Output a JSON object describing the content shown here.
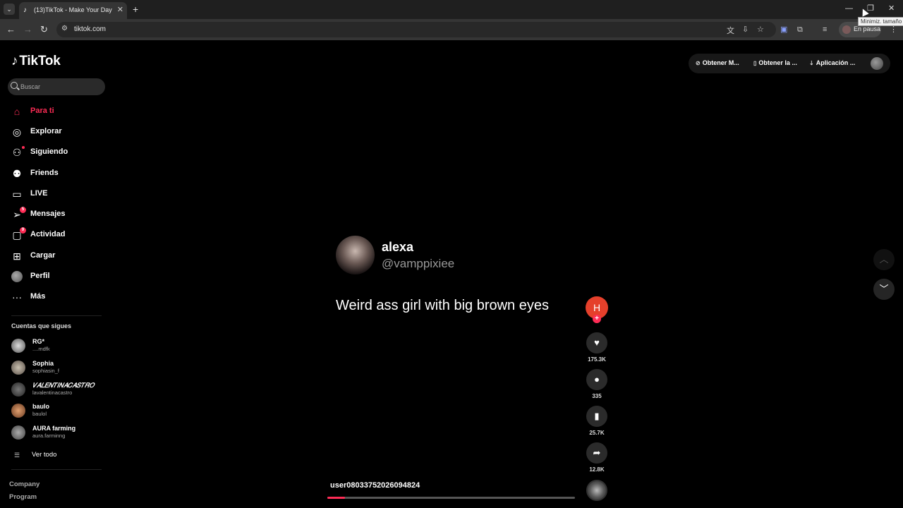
{
  "browser": {
    "tab_title": "(13)TikTok - Make Your Day",
    "url": "tiktok.com",
    "profile_label": "En pausa",
    "tooltip": "Minimiz. tamaño"
  },
  "sidebar": {
    "logo": "TikTok",
    "search_placeholder": "Buscar",
    "nav": [
      {
        "label": "Para ti",
        "icon": "home-icon"
      },
      {
        "label": "Explorar",
        "icon": "compass-icon"
      },
      {
        "label": "Siguiendo",
        "icon": "following-icon"
      },
      {
        "label": "Friends",
        "icon": "friends-icon"
      },
      {
        "label": "LIVE",
        "icon": "live-icon"
      },
      {
        "label": "Mensajes",
        "icon": "messages-icon",
        "badge": "5"
      },
      {
        "label": "Actividad",
        "icon": "activity-icon",
        "badge": "9"
      },
      {
        "label": "Cargar",
        "icon": "upload-icon"
      },
      {
        "label": "Perfil",
        "icon": "profile-icon"
      },
      {
        "label": "Más",
        "icon": "more-icon"
      }
    ],
    "following_title": "Cuentas que sigues",
    "following": [
      {
        "name": "RG*",
        "handle": "....mdfk"
      },
      {
        "name": "Sophia",
        "handle": "sophiasin_f"
      },
      {
        "name": "𝑉𝐴𝐿𝐸𝑁𝑇𝐼𝑁𝐴𝐶𝐴𝑆𝑇𝑅𝑂",
        "handle": "lavalentinacastro"
      },
      {
        "name": "baulo",
        "handle": "baulol"
      },
      {
        "name": "AURA farming",
        "handle": "aura.farminng"
      }
    ],
    "see_all": "Ver todo",
    "footer": [
      "Company",
      "Program"
    ]
  },
  "header": {
    "buttons": [
      "Obtener M...",
      "Obtener la ...",
      "Aplicación ..."
    ]
  },
  "post": {
    "name": "alexa",
    "handle": "@vamppixiee",
    "text": "Weird ass girl with big brown eyes",
    "user": "user08033752026094824",
    "progress": 0.07
  },
  "actions": {
    "creator_initial": "H",
    "likes": "175.3K",
    "comments": "335",
    "saves": "25.7K",
    "shares": "12.8K"
  }
}
